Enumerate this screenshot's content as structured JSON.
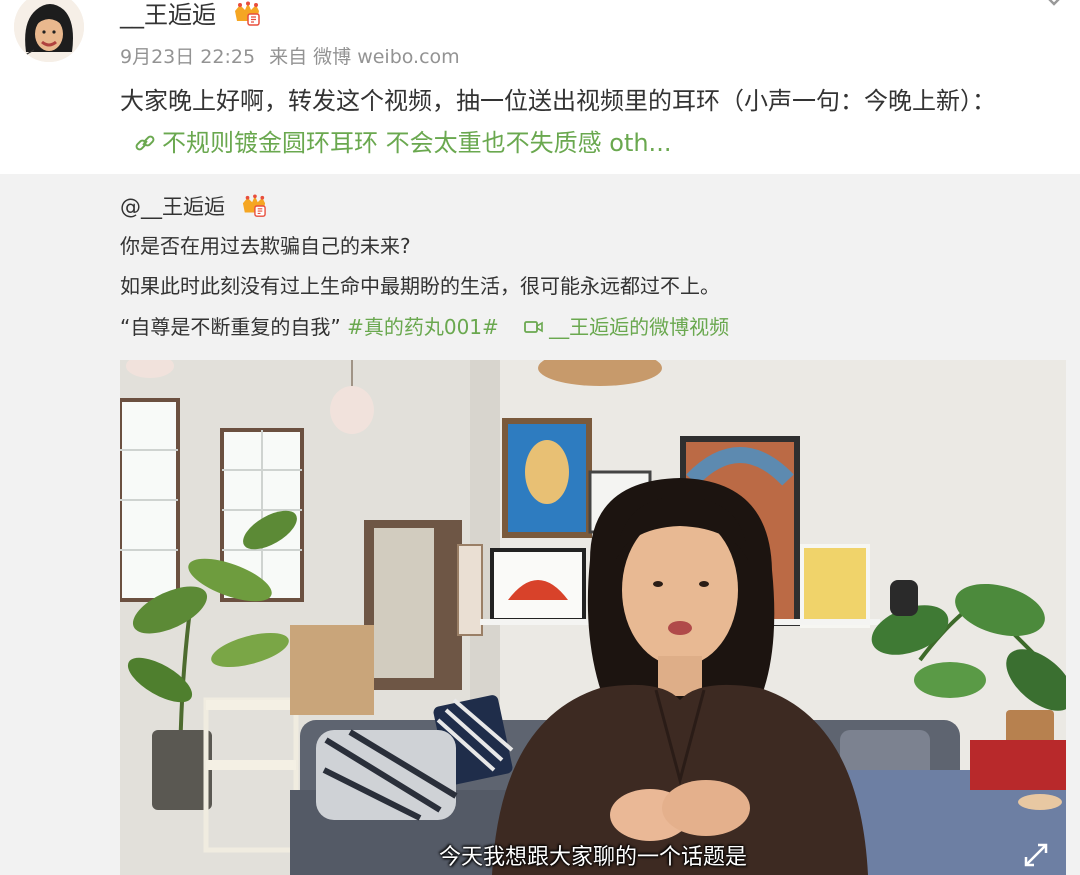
{
  "post": {
    "username": "__王逅逅",
    "time": "9月23日 22:25",
    "source": "来自 微博 weibo.com",
    "text": "大家晚上好啊，转发这个视频，抽一位送出视频里的耳环（小声一句：今晚上新）：",
    "link_text": "不规则镀金圆环耳环 不会太重也不失质感 oth..."
  },
  "repost": {
    "username": "@__王逅逅",
    "line1": "你是否在用过去欺骗自己的未来?",
    "line2": "如果此时此刻没有过上生命中最期盼的生活，很可能永远都过不上。",
    "line3_quote": "“自尊是不断重复的自我”",
    "hashtag": "#真的药丸001#",
    "video_link": "__王逅逅的微博视频"
  },
  "video": {
    "subtitle": "今天我想跟大家聊的一个话题是"
  },
  "colors": {
    "link_green": "#6aa84f",
    "meta_gray": "#939393",
    "repost_bg": "#f2f2f2"
  },
  "icons": [
    "crown-badge-icon",
    "link-icon",
    "video-camera-icon",
    "expand-icon",
    "chevron-down-icon"
  ]
}
